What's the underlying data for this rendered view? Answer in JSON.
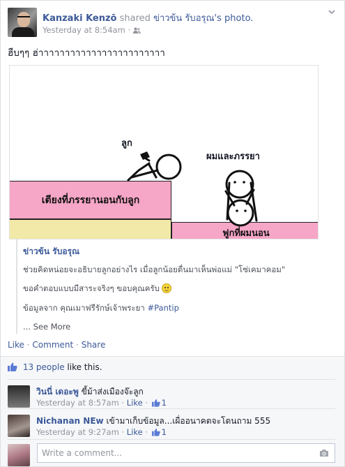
{
  "post": {
    "author": "Kanzaki Kenzō",
    "verb": "shared",
    "page_name": "ข่าวข้น รับอรุณ",
    "possessive": "'s photo.",
    "time": "Yesterday at 8:54am",
    "separator": "·",
    "status_text": "ฮืบๆๆ ฮ่าาาาาาาาาาาาาาาาาาาาาาาา"
  },
  "photo": {
    "label_child": "ลูก",
    "label_couple": "ผมและภรรยา",
    "label_bed": "เตียงที่ภรรยานอนกับลูก",
    "label_mattress": "ฟูกที่ผมนอน"
  },
  "attribution": {
    "title": "ข่าวข้น รับอรุณ",
    "line1": "ช่วยคิดหน่อยจะอธิบายลูกอย่างไร เมื่อลูกน้อยตื่นมาเห็นพ่อแม่ \"โซ่เคมาคอม\"",
    "line2": "ขอคำตอบแบบมีสาระจริงๆ ขอบคุณครับ",
    "line3_prefix": "ข้อมูลจาก คุณเมาฟรีรักษ์เจ้าพระยา",
    "line3_hashtag": "#Pantip",
    "see_more": "... See More"
  },
  "actions": {
    "like": "Like",
    "comment": "Comment",
    "share": "Share",
    "dot": "·"
  },
  "ufi": {
    "likes_count": "13 people",
    "likes_suffix": "like this.",
    "comments": [
      {
        "name": "วินนี่ เดอะพู",
        "text": "ขี้ม้าส่งเมืองจ๊ะลูก",
        "time": "Yesterday at 8:57am",
        "like": "Like",
        "likes": "1"
      },
      {
        "name": "Nichanan NEw",
        "text": "เข้ามาเก็บข้อมูล...เผื่ออนาคตจะโดนถาม 555",
        "time": "Yesterday at 9:27am",
        "like": "Like",
        "likes": "1"
      }
    ],
    "write_placeholder": "Write a comment..."
  },
  "colors": {
    "link": "#3b5998",
    "meta": "#90949c",
    "bed_pink": "#f6a6c7",
    "bed_base": "#f2e9a8"
  },
  "icons": {
    "audience": "friends-icon",
    "menu": "chevron-down-icon",
    "like": "thumbs-up-icon",
    "camera": "camera-icon",
    "emoji": "smile-emoji-icon"
  }
}
